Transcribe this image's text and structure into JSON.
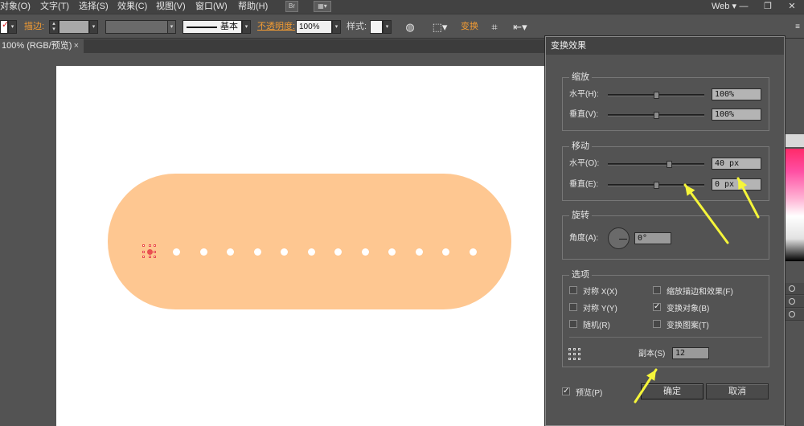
{
  "menubar": {
    "items": [
      "对象(O)",
      "文字(T)",
      "选择(S)",
      "效果(C)",
      "视图(V)",
      "窗口(W)",
      "帮助(H)"
    ],
    "br_icon": "Br",
    "workspace": "Web"
  },
  "controlbar": {
    "stroke_label": "描边:",
    "stroke_style": "基本",
    "opacity_label": "不透明度:",
    "opacity_value": "100%",
    "style_label": "样式:",
    "transform_label": "变换"
  },
  "tab": {
    "title": "100% (RGB/预览)",
    "close": "×"
  },
  "canvas": {
    "dot_count": 12
  },
  "dialog": {
    "title": "变换效果",
    "scale": {
      "title": "缩放",
      "horizontal_label": "水平(H):",
      "horizontal_value": "100%",
      "horizontal_slider": 0.5,
      "vertical_label": "垂直(V):",
      "vertical_value": "100%",
      "vertical_slider": 0.5
    },
    "move": {
      "title": "移动",
      "horizontal_label": "水平(O):",
      "horizontal_value": "40 px",
      "horizontal_slider": 0.65,
      "vertical_label": "垂直(E):",
      "vertical_value": "0 px",
      "vertical_slider": 0.5
    },
    "rotate": {
      "title": "旋转",
      "angle_label": "角度(A):",
      "angle_value": "0°"
    },
    "options": {
      "title": "选项",
      "reflect_x": {
        "label": "对称 X(X)",
        "checked": false
      },
      "reflect_y": {
        "label": "对称 Y(Y)",
        "checked": false
      },
      "random": {
        "label": "随机(R)",
        "checked": false
      },
      "scale_strokes": {
        "label": "缩放描边和效果(F)",
        "checked": false
      },
      "transform_objects": {
        "label": "变换对象(B)",
        "checked": true
      },
      "transform_patterns": {
        "label": "变换图案(T)",
        "checked": false
      },
      "copies_label": "副本(S)",
      "copies_value": "12"
    },
    "preview": {
      "label": "预览(P)",
      "checked": true
    },
    "ok_label": "确定",
    "cancel_label": "取消"
  },
  "colors": {
    "shape_fill": "#fec791",
    "annotation_arrow": "#f5f53a",
    "accent_orange": "#f39c33",
    "selection_red": "#e9504f"
  }
}
